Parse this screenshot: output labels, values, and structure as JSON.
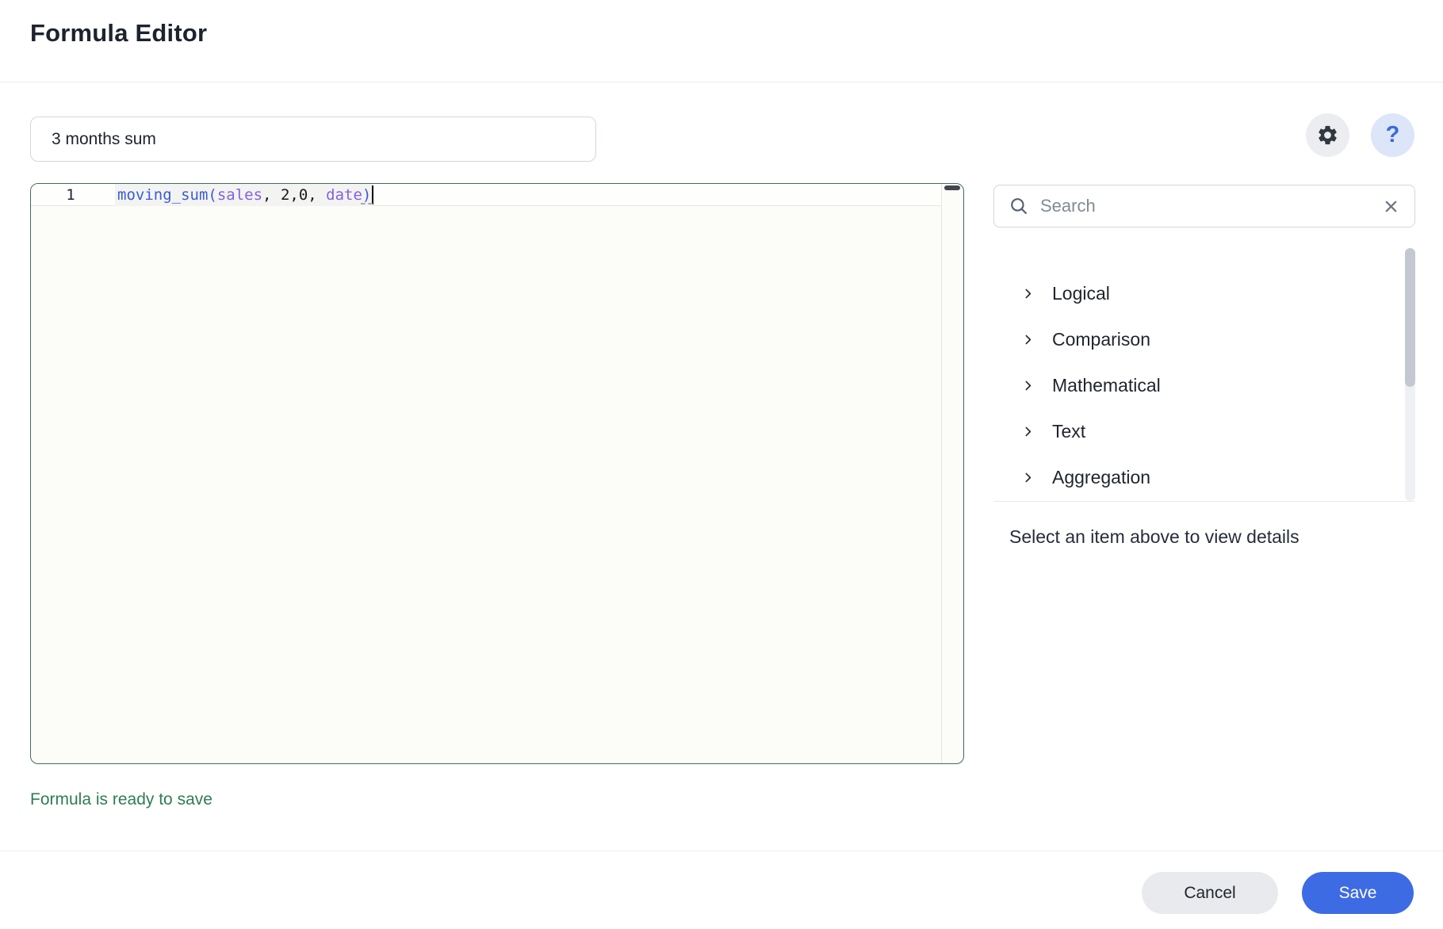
{
  "header": {
    "title": "Formula Editor"
  },
  "name_field": {
    "value": "3 months sum"
  },
  "toolbar": {
    "settings_icon": "gear-icon",
    "help_icon": "question-mark-icon",
    "help_glyph": "?"
  },
  "editor": {
    "line_number": "1",
    "full_text": "moving_sum(sales, 2,0, date)",
    "tokens": [
      {
        "text": "moving_sum(",
        "type": "function"
      },
      {
        "text": "sales",
        "type": "field"
      },
      {
        "text": ", ",
        "type": "plain"
      },
      {
        "text": "2,0",
        "type": "plain"
      },
      {
        "text": ", ",
        "type": "plain"
      },
      {
        "text": "date",
        "type": "field"
      },
      {
        "text": ")",
        "type": "function"
      }
    ]
  },
  "panel": {
    "search": {
      "placeholder": "Search",
      "clear_icon": "close-icon"
    },
    "categories": [
      "Logical",
      "Comparison",
      "Mathematical",
      "Text",
      "Aggregation"
    ],
    "hint": "Select an item above to view details"
  },
  "status": {
    "message": "Formula is ready to save"
  },
  "footer": {
    "cancel_label": "Cancel",
    "save_label": "Save"
  },
  "colors": {
    "accent_blue": "#3d6be4",
    "help_blue": "#3a6bd9",
    "editor_border_green": "#3e6f57",
    "status_green": "#2e7d52",
    "token_function_blue": "#3b5bd6",
    "token_field_purple": "#8460e4",
    "token_plain": "#16191f"
  }
}
